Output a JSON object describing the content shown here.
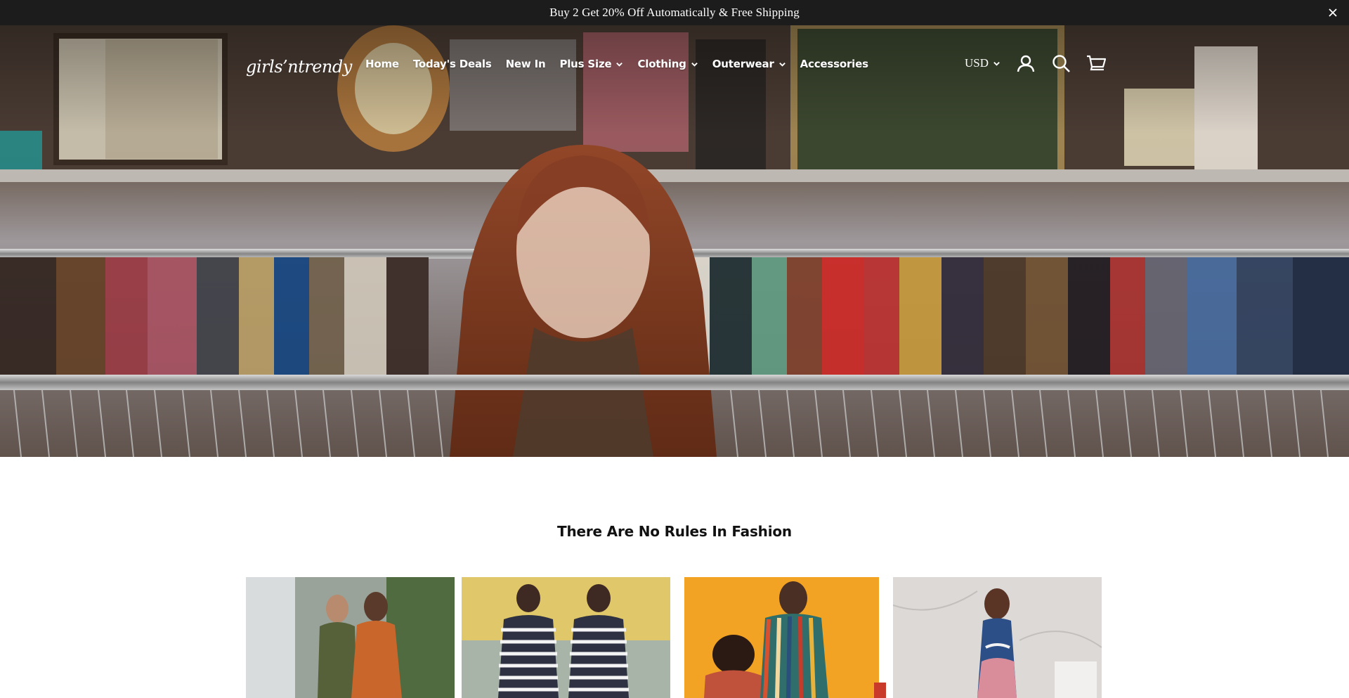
{
  "announcement": {
    "text": "Buy 2 Get 20% Off Automatically & Free Shipping"
  },
  "header": {
    "logo_text": "girls’ntrendy",
    "nav": [
      {
        "label": "Home",
        "has_dropdown": false
      },
      {
        "label": "Today's Deals",
        "has_dropdown": false
      },
      {
        "label": "New In",
        "has_dropdown": false
      },
      {
        "label": "Plus Size",
        "has_dropdown": true
      },
      {
        "label": "Clothing",
        "has_dropdown": true
      },
      {
        "label": "Outerwear",
        "has_dropdown": true
      },
      {
        "label": "Accessories",
        "has_dropdown": false
      }
    ],
    "currency": "USD",
    "icons": [
      "account-icon",
      "search-icon",
      "cart-icon"
    ]
  },
  "section": {
    "title": "There Are No Rules In Fashion"
  },
  "colors": {
    "announce_bg": "#1c1c1c",
    "text_light": "#ffffff",
    "text_dark": "#111111"
  }
}
